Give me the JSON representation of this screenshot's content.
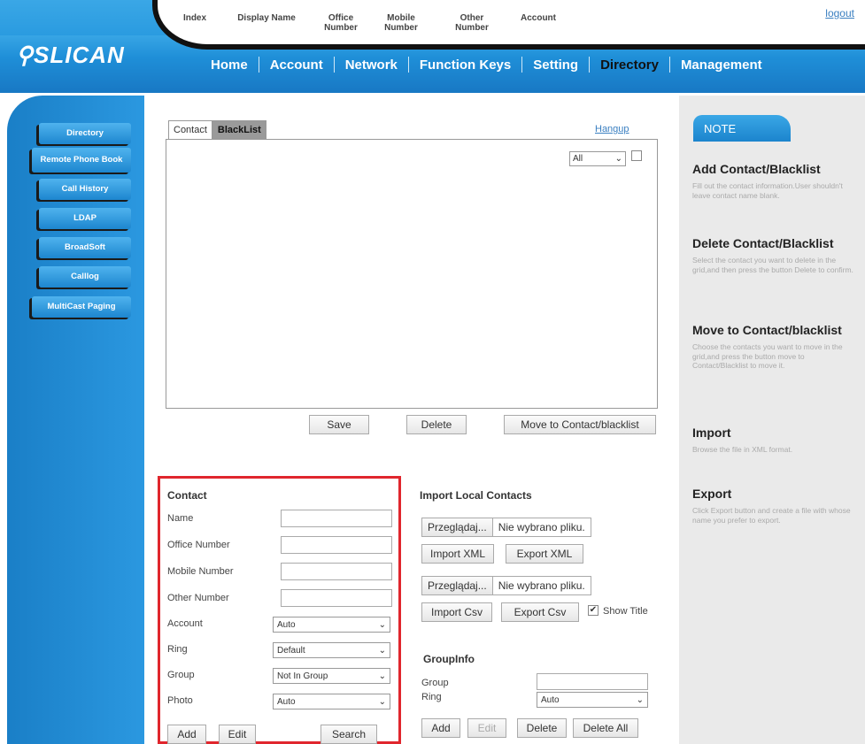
{
  "header": {
    "logo": "SLICAN",
    "logout": "logout",
    "nav": [
      "Home",
      "Account",
      "Network",
      "Function Keys",
      "Setting",
      "Directory",
      "Management"
    ]
  },
  "sidebar": {
    "items": [
      "Directory",
      "Remote Phone Book",
      "Call History",
      "LDAP",
      "BroadSoft",
      "Calllog",
      "MultiCast Paging"
    ]
  },
  "tabs": {
    "contact": "Contact",
    "blacklist": "BlackList",
    "hangup": "Hangup"
  },
  "grid": {
    "columns": [
      "Index",
      "Display Name",
      "Office Number",
      "Mobile Number",
      "Other Number",
      "Account"
    ],
    "account_filter": "All"
  },
  "grid_buttons": {
    "save": "Save",
    "delete": "Delete",
    "move": "Move to Contact/blacklist"
  },
  "contact_form": {
    "title": "Contact",
    "labels": {
      "name": "Name",
      "office": "Office Number",
      "mobile": "Mobile Number",
      "other": "Other Number",
      "account": "Account",
      "ring": "Ring",
      "group": "Group",
      "photo": "Photo"
    },
    "values": {
      "account": "Auto",
      "ring": "Default",
      "group": "Not In Group",
      "photo": "Auto"
    },
    "buttons": {
      "add": "Add",
      "edit": "Edit",
      "search": "Search"
    }
  },
  "import": {
    "title": "Import Local Contacts",
    "browse": "Przeglądaj...",
    "no_file": "Nie wybrano pliku.",
    "import_xml": "Import XML",
    "export_xml": "Export XML",
    "import_csv": "Import Csv",
    "export_csv": "Export Csv",
    "show_title": "Show Title"
  },
  "group_info": {
    "title": "GroupInfo",
    "group_label": "Group",
    "ring_label": "Ring",
    "ring_value": "Auto",
    "buttons": {
      "add": "Add",
      "edit": "Edit",
      "delete": "Delete",
      "delete_all": "Delete All"
    }
  },
  "note": {
    "tab": "NOTE",
    "sections": [
      {
        "title": "Add Contact/Blacklist",
        "text": "Fill out the contact information.User shouldn't leave contact name blank."
      },
      {
        "title": "Delete Contact/Blacklist",
        "text": "Select the contact you want to delete in the grid,and then press the button Delete to confirm."
      },
      {
        "title": "Move to Contact/blacklist",
        "text": "Choose the contacts you want to move in the grid,and press the button move to Contact/Blacklist to move it."
      },
      {
        "title": "Import",
        "text": "Browse the file in XML format."
      },
      {
        "title": "Export",
        "text": "Click Export button and create a file with whose name you prefer to export."
      }
    ]
  }
}
